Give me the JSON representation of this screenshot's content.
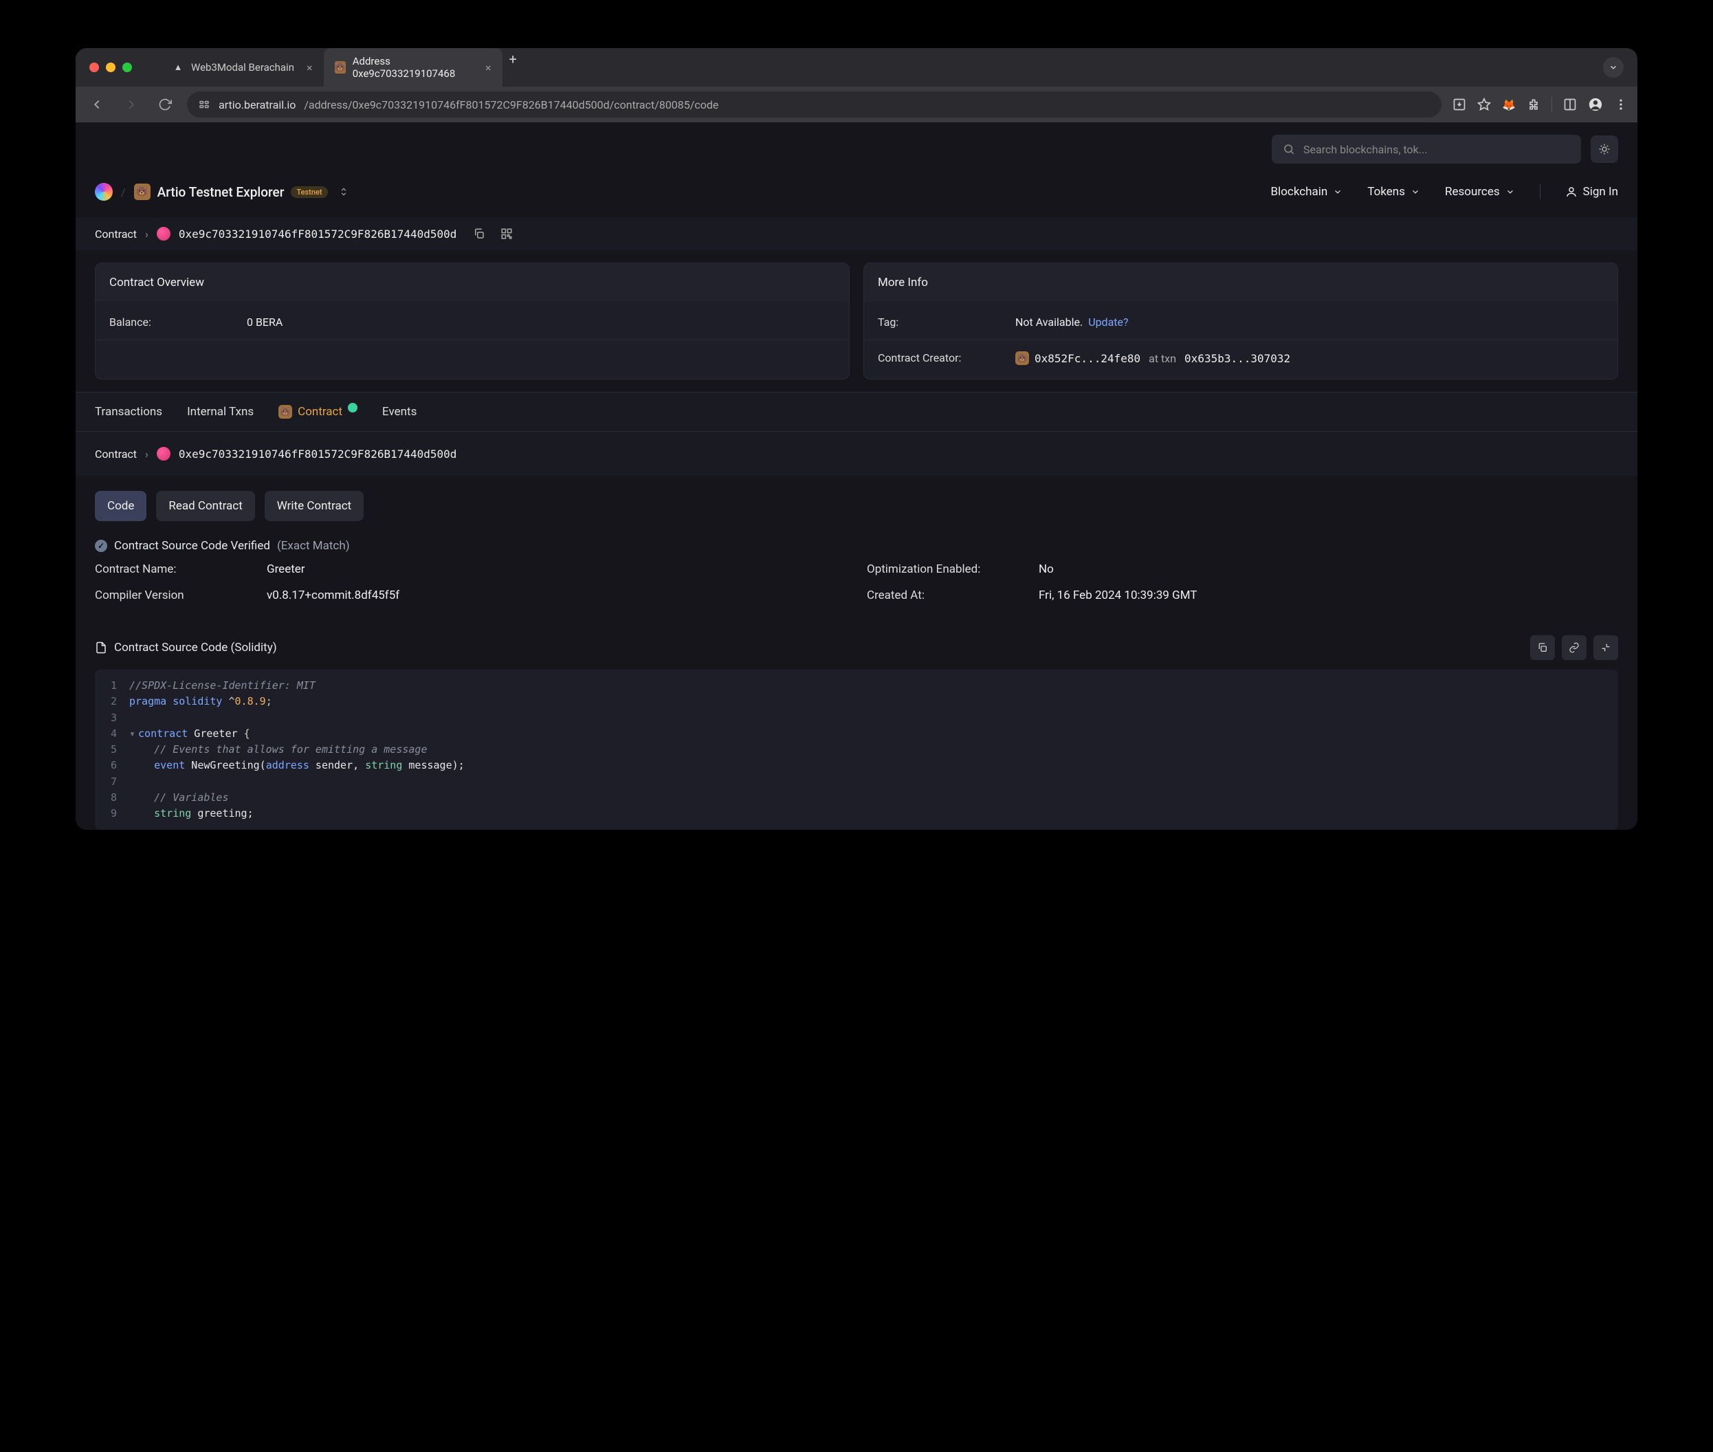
{
  "browser": {
    "tabs": [
      {
        "title": "Web3Modal Berachain",
        "favicon": "▲"
      },
      {
        "title": "Address 0xe9c7033219107468",
        "favicon": "🐻"
      }
    ],
    "url_host": "artio.beratrail.io",
    "url_path": "/address/0xe9c703321910746fF801572C9F826B17440d500d/contract/80085/code"
  },
  "search_placeholder": "Search blockchains, tok...",
  "explorer": {
    "title": "Artio Testnet Explorer",
    "badge": "Testnet"
  },
  "nav": {
    "blockchain": "Blockchain",
    "tokens": "Tokens",
    "resources": "Resources",
    "signin": "Sign In"
  },
  "breadcrumb": {
    "label": "Contract",
    "address": "0xe9c703321910746fF801572C9F826B17440d500d"
  },
  "overview": {
    "title": "Contract Overview",
    "balance_label": "Balance:",
    "balance_value": "0 BERA"
  },
  "moreinfo": {
    "title": "More Info",
    "tag_label": "Tag:",
    "tag_value": "Not Available.",
    "update": "Update?",
    "creator_label": "Contract Creator:",
    "creator_addr": "0x852Fc...24fe80",
    "at_txn": "at txn",
    "txn_hash": "0x635b3...307032"
  },
  "tabs": {
    "transactions": "Transactions",
    "internal": "Internal Txns",
    "contract": "Contract",
    "events": "Events"
  },
  "subtabs": {
    "code": "Code",
    "read": "Read Contract",
    "write": "Write Contract"
  },
  "verified": {
    "text": "Contract Source Code Verified",
    "match": "(Exact Match)"
  },
  "details": {
    "name_label": "Contract Name:",
    "name_value": "Greeter",
    "opt_label": "Optimization Enabled:",
    "opt_value": "No",
    "compiler_label": "Compiler Version",
    "compiler_value": "v0.8.17+commit.8df45f5f",
    "created_label": "Created At:",
    "created_value": "Fri, 16 Feb 2024 10:39:39 GMT"
  },
  "source": {
    "title": "Contract Source Code (Solidity)"
  },
  "code_lines": [
    "//SPDX-License-Identifier: MIT",
    "pragma solidity ^0.8.9;",
    "",
    "contract Greeter {",
    "    // Events that allows for emitting a message",
    "    event NewGreeting(address sender, string message);",
    "",
    "    // Variables",
    "    string greeting;"
  ]
}
